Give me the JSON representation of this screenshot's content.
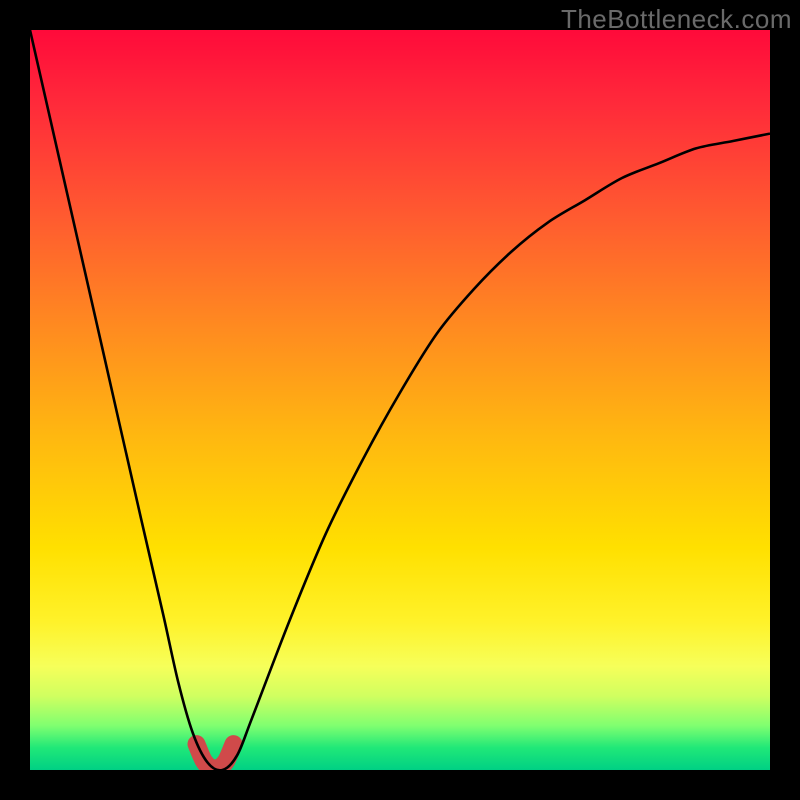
{
  "watermark": "TheBottleneck.com",
  "colors": {
    "gradient_top": "#ff0a3a",
    "gradient_mid": "#ffe000",
    "gradient_bottom": "#00d084",
    "curve_color": "#000000",
    "trough_color": "#d04a4a",
    "frame_bg": "#000000"
  },
  "chart_data": {
    "type": "line",
    "title": "",
    "xlabel": "",
    "ylabel": "",
    "xlim": [
      0,
      100
    ],
    "ylim": [
      0,
      100
    ],
    "grid": false,
    "legend": null,
    "annotations": [],
    "series": [
      {
        "name": "curve",
        "x": [
          0,
          5,
          10,
          15,
          18,
          20,
          22,
          24,
          26,
          28,
          30,
          35,
          40,
          45,
          50,
          55,
          60,
          65,
          70,
          75,
          80,
          85,
          90,
          95,
          100
        ],
        "values": [
          100,
          78,
          56,
          34,
          21,
          12,
          5,
          1,
          0,
          2,
          7,
          20,
          32,
          42,
          51,
          59,
          65,
          70,
          74,
          77,
          80,
          82,
          84,
          85,
          86
        ]
      }
    ],
    "highlight": {
      "name": "trough",
      "x": [
        22.5,
        23.5,
        24.5,
        25.5,
        26.5,
        27.5
      ],
      "values": [
        3.5,
        1.2,
        0.3,
        0.3,
        1.2,
        3.5
      ]
    },
    "notes": "Axes have no tick labels or numeric scale in the source image; values are read off as percentages of the plotting area (0 = bottom/left, 100 = top/right). The curve drops sharply to a minimum near x≈25 then rises with diminishing slope toward the right edge. A short thick salmon-colored stroke highlights the trough region."
  }
}
